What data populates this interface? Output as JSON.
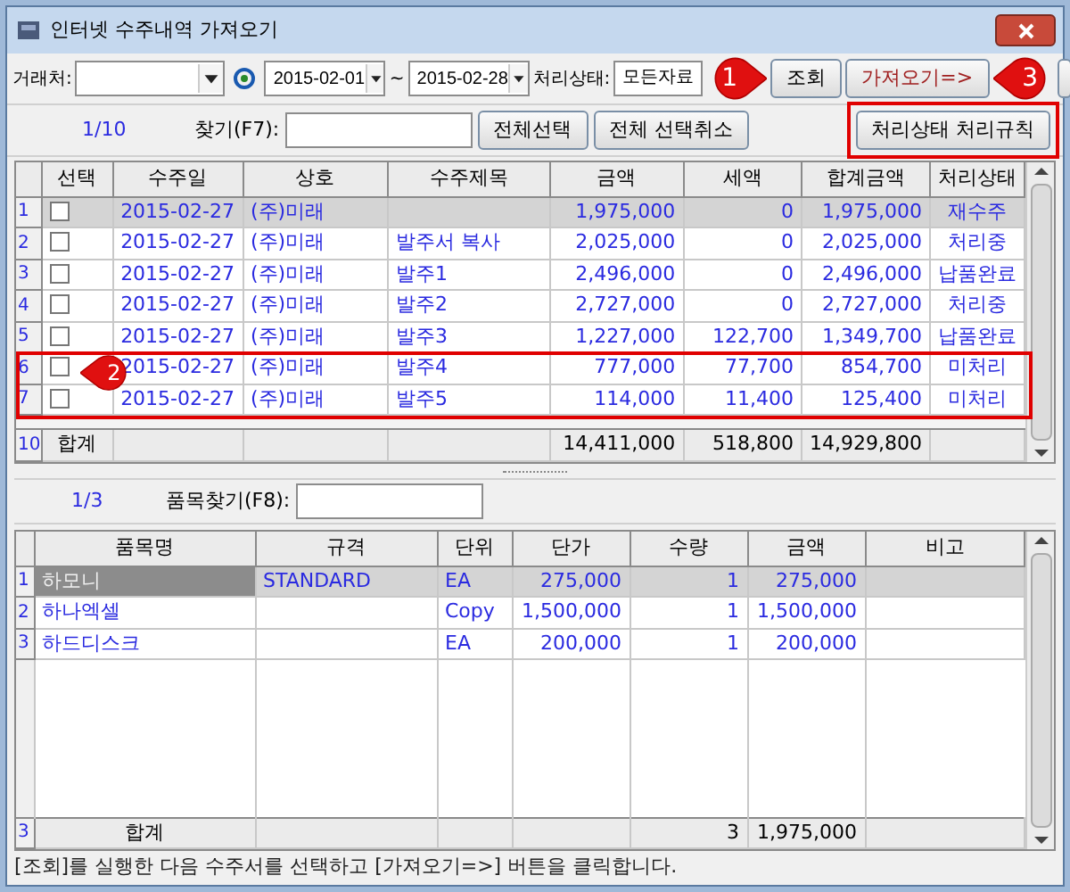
{
  "window": {
    "title": "인터넷 수주내역 가져오기"
  },
  "toolbar": {
    "client_label": "거래처:",
    "date_from": "2015-02-01",
    "tilde": "~",
    "date_to": "2015-02-28",
    "status_label": "처리상태:",
    "status_value": "모든자료",
    "buttons": [
      "조회",
      "가져오기=>"
    ]
  },
  "order_bar": {
    "count": "1/10",
    "find_label": "찾기(F7):",
    "buttons": [
      "전체선택",
      "전체 선택취소"
    ],
    "rule_button": "처리상태 처리규칙"
  },
  "orders": {
    "columns": [
      "선택",
      "수주일",
      "상호",
      "수주제목",
      "금액",
      "세액",
      "합계금액",
      "처리상태"
    ],
    "rows": [
      {
        "num": "1",
        "selected": true,
        "checked": false,
        "date": "2015-02-27",
        "company": "(주)미래",
        "amount": "1,975,000",
        "tax": "0",
        "total": "1,975,000",
        "status": "재수주"
      },
      {
        "num": "2",
        "selected": false,
        "checked": false,
        "date": "2015-02-27",
        "company": "(주)미래",
        "title": "발주서 복사",
        "amount": "2,025,000",
        "tax": "0",
        "total": "2,025,000",
        "status": "처리중"
      },
      {
        "num": "3",
        "selected": false,
        "checked": false,
        "date": "2015-02-27",
        "company": "(주)미래",
        "title": "발주1",
        "amount": "2,496,000",
        "tax": "0",
        "total": "2,496,000",
        "status": "납품완료"
      },
      {
        "num": "4",
        "selected": false,
        "checked": false,
        "date": "2015-02-27",
        "company": "(주)미래",
        "title": "발주2",
        "amount": "2,727,000",
        "tax": "0",
        "total": "2,727,000",
        "status": "처리중"
      },
      {
        "num": "5",
        "selected": false,
        "checked": false,
        "date": "2015-02-27",
        "company": "(주)미래",
        "title": "발주3",
        "amount": "1,227,000",
        "tax": "122,700",
        "total": "1,349,700",
        "status": "납품완료"
      },
      {
        "num": "6",
        "selected": false,
        "checked": false,
        "date": "2015-02-27",
        "company": "(주)미래",
        "title": "발주4",
        "amount": "777,000",
        "tax": "77,700",
        "total": "854,700",
        "status": "미처리"
      },
      {
        "num": "7",
        "selected": false,
        "checked": false,
        "date": "2015-02-27",
        "company": "(주)미래",
        "title": "발주5",
        "amount": "114,000",
        "tax": "11,400",
        "total": "125,400",
        "status": "미처리"
      }
    ],
    "total": {
      "num": "10",
      "label": "합계",
      "amount": "14,411,000",
      "tax": "518,800",
      "total": "14,929,800"
    }
  },
  "item_bar": {
    "count": "1/3",
    "find_label": "품목찾기(F8):"
  },
  "items": {
    "columns": [
      "품목명",
      "규격",
      "단위",
      "단가",
      "수량",
      "금액",
      "비고"
    ],
    "rows": [
      {
        "num": "1",
        "selected": true,
        "name": "하모니",
        "spec": "STANDARD",
        "unit": "EA",
        "price": "275,000",
        "qty": "1",
        "amount": "275,000"
      },
      {
        "num": "2",
        "selected": false,
        "name": "하나엑셀",
        "unit": "Copy",
        "price": "1,500,000",
        "qty": "1",
        "amount": "1,500,000"
      },
      {
        "num": "3",
        "selected": false,
        "name": "하드디스크",
        "unit": "EA",
        "price": "200,000",
        "qty": "1",
        "amount": "200,000"
      }
    ],
    "total": {
      "num": "3",
      "label": "합계",
      "qty": "3",
      "amount": "1,975,000"
    }
  },
  "status_bar": "[조회]를 실행한 다음 수주서를 선택하고 [가져오기=>] 버튼을 클릭합니다.",
  "annotations": [
    {
      "number": "1"
    },
    {
      "number": "2"
    },
    {
      "number": "3"
    }
  ]
}
